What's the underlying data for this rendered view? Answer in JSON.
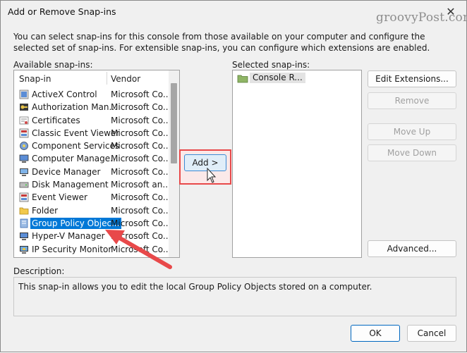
{
  "window": {
    "title": "Add or Remove Snap-ins",
    "watermark": "groovyPost.com"
  },
  "intro": "You can select snap-ins for this console from those available on your computer and configure the selected set of snap-ins. For extensible snap-ins, you can configure which extensions are enabled.",
  "available": {
    "label": "Available snap-ins:",
    "col_snapin": "Snap-in",
    "col_vendor": "Vendor",
    "items": [
      {
        "name": "ActiveX Control",
        "vendor": "Microsoft Co...",
        "icon": "activex-icon"
      },
      {
        "name": "Authorization Man...",
        "vendor": "Microsoft Co...",
        "icon": "authorization-icon"
      },
      {
        "name": "Certificates",
        "vendor": "Microsoft Co...",
        "icon": "certificate-icon"
      },
      {
        "name": "Classic Event Viewer",
        "vendor": "Microsoft Co...",
        "icon": "event-viewer-icon"
      },
      {
        "name": "Component Services",
        "vendor": "Microsoft Co...",
        "icon": "component-services-icon"
      },
      {
        "name": "Computer Manage...",
        "vendor": "Microsoft Co...",
        "icon": "computer-management-icon"
      },
      {
        "name": "Device Manager",
        "vendor": "Microsoft Co...",
        "icon": "device-manager-icon"
      },
      {
        "name": "Disk Management",
        "vendor": "Microsoft an...",
        "icon": "disk-icon"
      },
      {
        "name": "Event Viewer",
        "vendor": "Microsoft Co...",
        "icon": "event-viewer-icon"
      },
      {
        "name": "Folder",
        "vendor": "Microsoft Co...",
        "icon": "folder-icon"
      },
      {
        "name": "Group Policy Objec...",
        "vendor": "Microsoft Co...",
        "icon": "group-policy-icon"
      },
      {
        "name": "Hyper-V Manager",
        "vendor": "Microsoft Co...",
        "icon": "hyperv-icon"
      },
      {
        "name": "IP Security Monitor",
        "vendor": "Microsoft Co...",
        "icon": "ip-security-icon"
      }
    ],
    "selected_index": 10
  },
  "add_button": "Add >",
  "selected": {
    "label": "Selected snap-ins:",
    "items": [
      {
        "name": "Console R...",
        "icon": "folder-icon"
      }
    ]
  },
  "buttons": {
    "edit_extensions": "Edit Extensions...",
    "remove": "Remove",
    "move_up": "Move Up",
    "move_down": "Move Down",
    "advanced": "Advanced...",
    "ok": "OK",
    "cancel": "Cancel"
  },
  "description": {
    "label": "Description:",
    "text": "This snap-in allows you to edit the local Group Policy Objects stored on a computer."
  },
  "colors": {
    "selection": "#0078d7",
    "highlight_red": "#e8494a"
  }
}
